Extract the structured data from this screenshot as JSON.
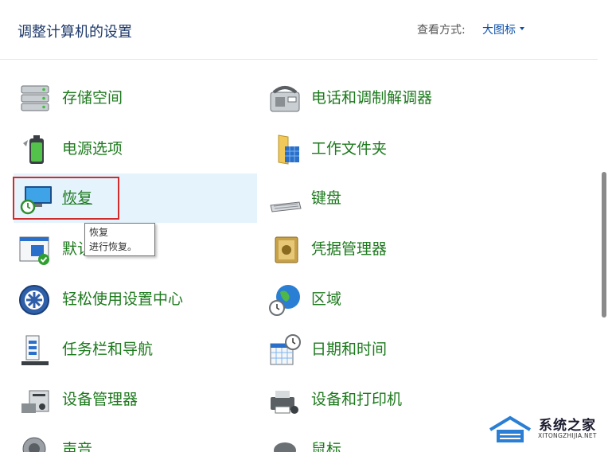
{
  "header": {
    "title": "调整计算机的设置",
    "view_label": "查看方式:",
    "view_value": "大图标"
  },
  "items_left": [
    {
      "label": "存储空间",
      "icon": "storage-icon"
    },
    {
      "label": "电源选项",
      "icon": "power-options-icon"
    },
    {
      "label": "恢复",
      "icon": "recovery-icon"
    },
    {
      "label": "默认",
      "icon": "default-programs-icon"
    },
    {
      "label": "轻松使用设置中心",
      "icon": "ease-of-access-icon"
    },
    {
      "label": "任务栏和导航",
      "icon": "taskbar-icon"
    },
    {
      "label": "设备管理器",
      "icon": "device-manager-icon"
    },
    {
      "label": "声音",
      "icon": "sound-icon"
    }
  ],
  "items_right": [
    {
      "label": "电话和调制解调器",
      "icon": "phone-modem-icon"
    },
    {
      "label": "工作文件夹",
      "icon": "work-folders-icon"
    },
    {
      "label": "键盘",
      "icon": "keyboard-icon"
    },
    {
      "label": "凭据管理器",
      "icon": "credential-manager-icon"
    },
    {
      "label": "区域",
      "icon": "region-icon"
    },
    {
      "label": "日期和时间",
      "icon": "date-time-icon"
    },
    {
      "label": "设备和打印机",
      "icon": "devices-printers-icon"
    },
    {
      "label": "鼠标",
      "icon": "mouse-icon"
    }
  ],
  "tooltip": {
    "line1": "恢复",
    "line2": "进行恢复。"
  },
  "watermark": {
    "brand": "系统之家",
    "url": "XITONGZHIJIA.NET"
  },
  "colors": {
    "link_green": "#1d7a1d",
    "hover_bg": "#e5f3fd",
    "highlight_red": "#d12b2b",
    "title_blue": "#1f3a6b"
  }
}
